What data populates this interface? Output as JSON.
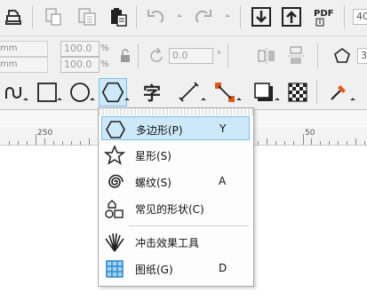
{
  "toolbar_top": {
    "font_size_value": "40"
  },
  "property_bar": {
    "width_unit": "mm",
    "height_unit": "mm",
    "scale_x_value": "100.0",
    "scale_y_value": "100.0",
    "scale_unit": "%",
    "rotation_value": "0.0",
    "polygon_points_value": "3"
  },
  "ruler": {
    "label_left": "250",
    "label_right": "50"
  },
  "shape_menu": {
    "items": [
      {
        "label": "多边形(P)",
        "shortcut": "Y",
        "icon": "polygon-icon",
        "selected": true
      },
      {
        "label": "星形(S)",
        "shortcut": "",
        "icon": "star-icon"
      },
      {
        "label": "螺纹(S)",
        "shortcut": "A",
        "icon": "spiral-icon"
      },
      {
        "label": "常见的形状(C)",
        "shortcut": "",
        "icon": "common-shapes-icon"
      },
      {
        "label": "冲击效果工具",
        "shortcut": "",
        "icon": "impact-effect-icon"
      },
      {
        "label": "图纸(G)",
        "shortcut": "D",
        "icon": "graph-paper-icon"
      }
    ]
  },
  "colors": {
    "toolbar_bg": "#f0f0f0",
    "menu_highlight": "#cde8f8",
    "menu_highlight_border": "#7dbfe6",
    "accent_orange": "#e05a1a"
  }
}
